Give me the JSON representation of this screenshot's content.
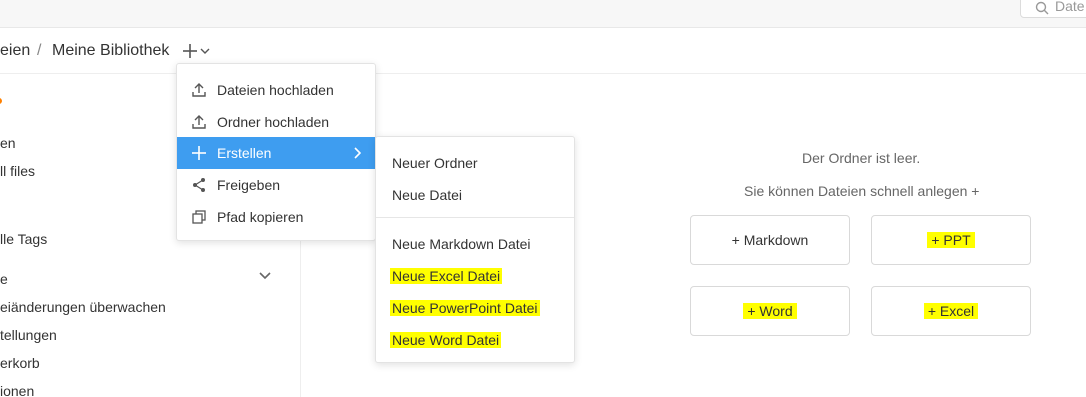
{
  "search": {
    "placeholder": "Date"
  },
  "breadcrumb": {
    "parent": "eien",
    "separator": "/",
    "current": "Meine Bibliothek"
  },
  "sidebar": {
    "items": [
      {
        "label": "en"
      },
      {
        "label": "ll files"
      },
      {
        "label": "lle Tags"
      },
      {
        "label": "e"
      },
      {
        "label": "eiänderungen überwachen"
      },
      {
        "label": "tellungen"
      },
      {
        "label": "erkorb"
      },
      {
        "label": "ionen"
      }
    ]
  },
  "menu": {
    "items": [
      {
        "label": "Dateien hochladen",
        "icon": "upload-icon"
      },
      {
        "label": "Ordner hochladen",
        "icon": "upload-icon"
      },
      {
        "label": "Erstellen",
        "icon": "plus-icon"
      },
      {
        "label": "Freigeben",
        "icon": "share-icon"
      },
      {
        "label": "Pfad kopieren",
        "icon": "copy-icon"
      }
    ]
  },
  "submenu": {
    "items": [
      {
        "label": "Neuer Ordner"
      },
      {
        "label": "Neue Datei"
      },
      {
        "label": "Neue Markdown Datei"
      },
      {
        "label": "Neue Excel Datei"
      },
      {
        "label": "Neue PowerPoint Datei"
      },
      {
        "label": "Neue Word Datei"
      }
    ]
  },
  "empty": {
    "title": "Der Ordner ist leer.",
    "hint": "Sie können Dateien schnell anlegen +"
  },
  "quick_create": {
    "markdown": "+ Markdown",
    "ppt": "+ PPT",
    "word": "+ Word",
    "excel": "+ Excel"
  },
  "colors": {
    "accent": "#3e9df0",
    "highlight": "#ffff00",
    "dot": "#ff8000"
  }
}
